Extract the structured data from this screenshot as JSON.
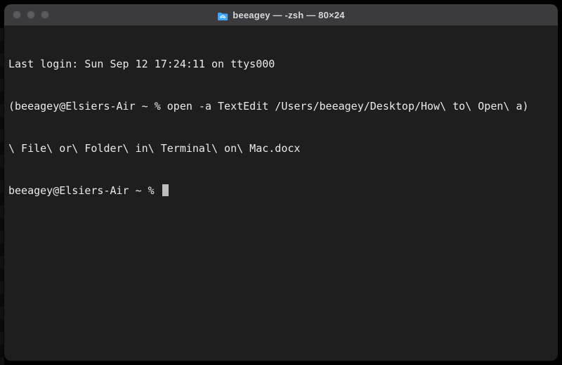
{
  "window": {
    "title": "beeagey — -zsh — 80×24",
    "icon": "home-folder-icon",
    "icon_color": "#3ea6ff"
  },
  "terminal": {
    "last_login": "Last login: Sun Sep 12 17:24:11 on ttys000",
    "command_line_1": "(beeagey@Elsiers-Air ~ % open -a TextEdit /Users/beeagey/Desktop/How\\ to\\ Open\\ a)",
    "command_line_2": "\\ File\\ or\\ Folder\\ in\\ Terminal\\ on\\ Mac.docx",
    "prompt": "beeagey@Elsiers-Air ~ % "
  }
}
